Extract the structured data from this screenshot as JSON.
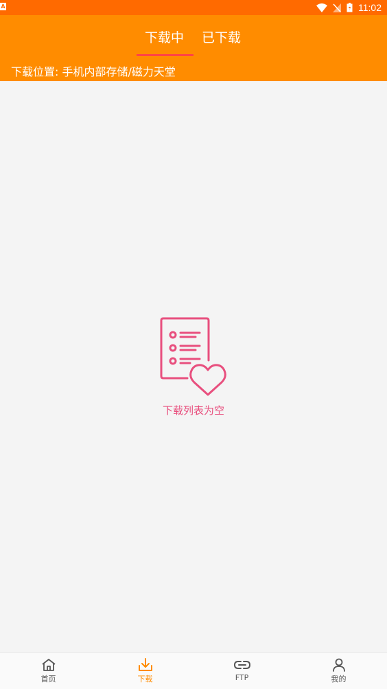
{
  "status_bar": {
    "time": "11:02",
    "left_icon": "A"
  },
  "tabs": [
    {
      "label": "下载中",
      "active": true
    },
    {
      "label": "已下载",
      "active": false
    }
  ],
  "location_label": "下载位置: 手机内部存储/磁力天堂",
  "empty_state": {
    "message": "下载列表为空",
    "icon": "list-heart-icon"
  },
  "bottom_nav": [
    {
      "label": "首页",
      "icon": "home-icon",
      "active": false
    },
    {
      "label": "下载",
      "icon": "download-icon",
      "active": true
    },
    {
      "label": "FTP",
      "icon": "link-icon",
      "active": false
    },
    {
      "label": "我的",
      "icon": "person-icon",
      "active": false
    }
  ],
  "colors": {
    "status_bar": "#ff6a00",
    "header": "#ff8c00",
    "accent": "#ff8c00",
    "indicator": "#ff2f5a",
    "empty_pink": "#e84f7e"
  }
}
